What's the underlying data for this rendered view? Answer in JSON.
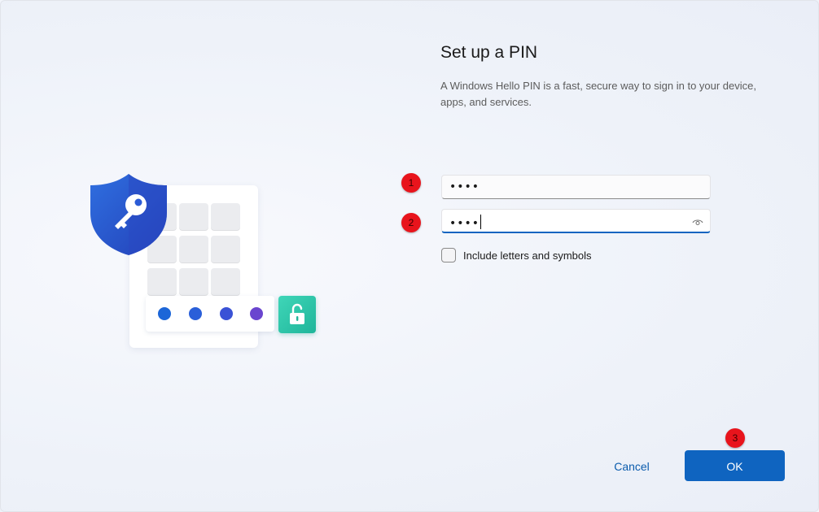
{
  "page": {
    "title": "Set up a PIN",
    "description": "A Windows Hello PIN is a fast, secure way to sign in to your device, apps, and services."
  },
  "pin_field": {
    "value_masked": "••••",
    "step_badge": "1"
  },
  "confirm_pin_field": {
    "value_masked": "••••",
    "step_badge": "2",
    "reveal_icon": "eye-icon"
  },
  "include_letters_checkbox": {
    "label": "Include letters and symbols",
    "checked": false
  },
  "actions": {
    "cancel_label": "Cancel",
    "ok_label": "OK",
    "ok_step_badge": "3"
  },
  "illustration": {
    "shield_icon": "key-icon",
    "lock_icon": "unlocked-padlock-icon",
    "pin_dot_colors": [
      "#1c66d8",
      "#2a5fd9",
      "#3a52d6",
      "#6a45cf"
    ]
  },
  "colors": {
    "accent": "#0f64c0",
    "badge": "#e8141c",
    "lock_tile": "#2cc7aa"
  }
}
